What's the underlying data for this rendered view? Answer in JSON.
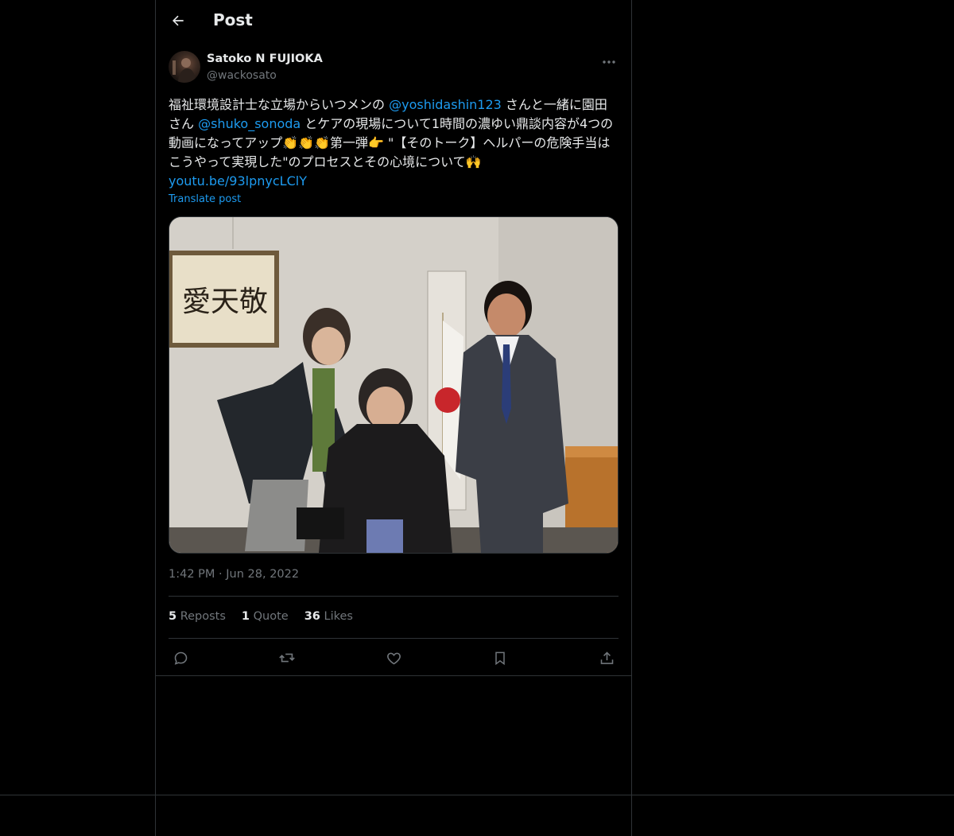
{
  "header": {
    "title": "Post",
    "back_icon": "arrow-left-icon"
  },
  "post": {
    "author": {
      "name": "Satoko N FUJIOKA",
      "handle": "@wackosato"
    },
    "more_icon": "more-horizontal-icon",
    "text": {
      "seg1": "福祉環境設計士な立場からいつメンの ",
      "mention1": "@yoshidashin123",
      "seg2": " さんと一緒に園田さん ",
      "mention2": "@shuko_sonoda",
      "seg3": " とケアの現場について1時間の濃ゆい鼎談内容が4つの動画になってアップ",
      "emoji_clap": "👏👏👏",
      "seg4": "第一弾",
      "emoji_point": "👉",
      "seg5": " \"【そのトーク】ヘルパーの危険手当はこうやって実現した\"のプロセスとその心境について",
      "emoji_hands": "🙌",
      "link": "youtu.be/93lpnycLClY"
    },
    "translate_label": "Translate post",
    "timestamp": {
      "time": "1:42 PM",
      "separator": "·",
      "date": "Jun 28, 2022"
    },
    "stats": {
      "reposts_count": "5",
      "reposts_label": "Reposts",
      "quotes_count": "1",
      "quotes_label": "Quote",
      "likes_count": "36",
      "likes_label": "Likes"
    },
    "actions": [
      "reply-icon",
      "repost-icon",
      "like-icon",
      "bookmark-icon",
      "share-icon"
    ]
  },
  "colors": {
    "background": "#000000",
    "text": "#e7e9ea",
    "muted": "#71767b",
    "accent": "#1d9bf0",
    "border": "#2f3336"
  }
}
